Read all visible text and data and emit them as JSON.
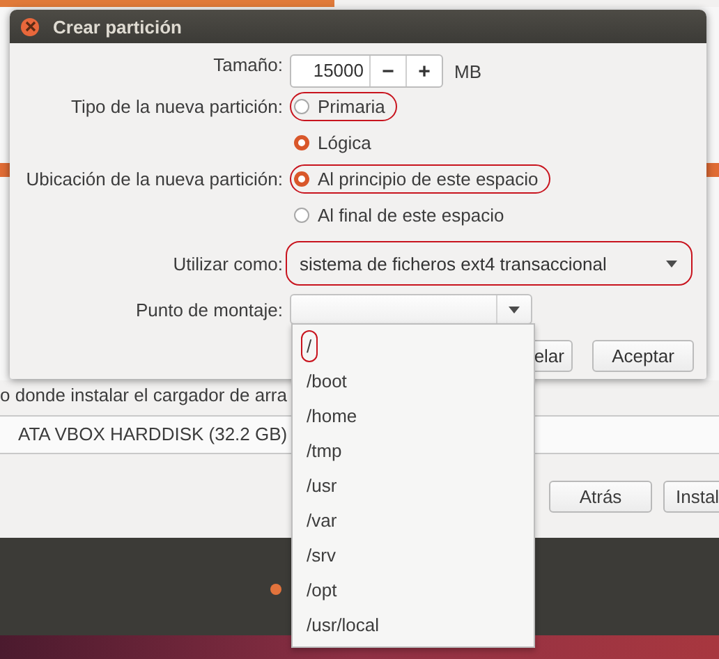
{
  "background_window": {
    "bootloader_label": "o donde instalar el cargador de arra",
    "bootloader_device": "ATA VBOX HARDDISK (32.2 GB)",
    "buttons": [
      "Atrás",
      "Instal"
    ]
  },
  "dialog": {
    "title": "Crear partición",
    "size": {
      "label": "Tamaño:",
      "value": "15000",
      "decrement": "−",
      "increment": "+",
      "unit": "MB"
    },
    "type": {
      "label": "Tipo de la nueva partición:",
      "options": [
        {
          "label": "Primaria",
          "selected": false,
          "annotated": true
        },
        {
          "label": "Lógica",
          "selected": true,
          "annotated": false
        }
      ]
    },
    "location": {
      "label": "Ubicación de la nueva partición:",
      "options": [
        {
          "label": "Al principio de este espacio",
          "selected": true,
          "annotated": true
        },
        {
          "label": "Al final de este espacio",
          "selected": false,
          "annotated": false
        }
      ]
    },
    "use_as": {
      "label": "Utilizar como:",
      "value": "sistema de ficheros ext4 transaccional",
      "annotated": true
    },
    "mount_point": {
      "label": "Punto de montaje:"
    },
    "buttons": [
      {
        "label": "elar"
      },
      {
        "label": "Aceptar"
      }
    ]
  },
  "mount_menu": {
    "items": [
      {
        "label": "/",
        "annotated": true
      },
      {
        "label": "/boot",
        "annotated": false
      },
      {
        "label": "/home",
        "annotated": false
      },
      {
        "label": "/tmp",
        "annotated": false
      },
      {
        "label": "/usr",
        "annotated": false
      },
      {
        "label": "/var",
        "annotated": false
      },
      {
        "label": "/srv",
        "annotated": false
      },
      {
        "label": "/opt",
        "annotated": false
      },
      {
        "label": "/usr/local",
        "annotated": false
      }
    ]
  }
}
